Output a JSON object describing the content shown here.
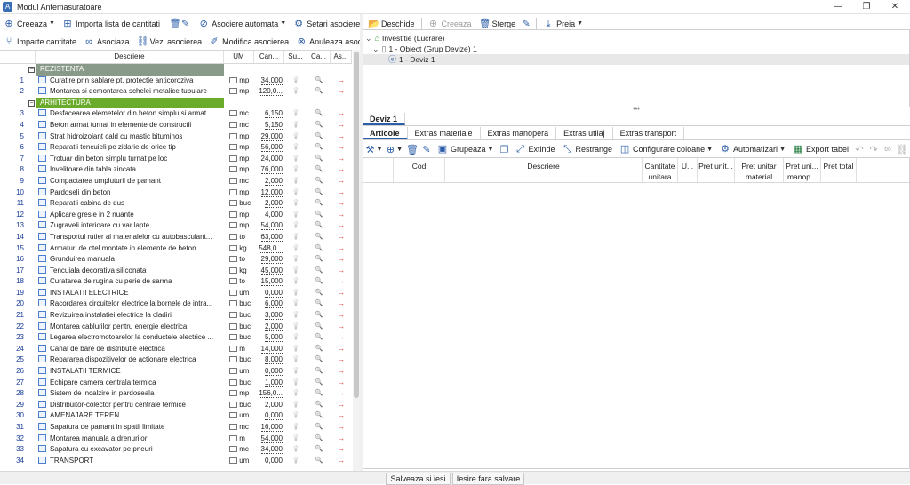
{
  "window": {
    "title": "Modul Antemasuratoare",
    "controls": [
      "—",
      "❐",
      "✕"
    ]
  },
  "left_toolbar1": {
    "create": "Creeaza",
    "import": "Importa lista de cantitati",
    "auto_assoc": "Asociere automata",
    "assoc_settings": "Setari asociere"
  },
  "left_toolbar2": {
    "split_qty": "Imparte cantitate",
    "associate": "Asociaza",
    "view_assoc": "Vezi asocierea",
    "modify_assoc": "Modifica asocierea",
    "cancel_assoc": "Anuleaza asocierea"
  },
  "left_grid": {
    "headers": {
      "desc": "Descriere",
      "um": "UM",
      "qty": "Can...",
      "su": "Su...",
      "ca": "Ca...",
      "as": "As..."
    },
    "groups": {
      "rezistenta": "REZISTENTA",
      "arhitectura": "ARHITECTURA"
    },
    "rows": [
      {
        "n": "1",
        "d": "Curatire prin sablare pt. protectie anticoroziva",
        "u": "mp",
        "q": "34,000"
      },
      {
        "n": "2",
        "d": "Montarea si demontarea schelei metalice tubulare",
        "u": "mp",
        "q": "120,0..."
      },
      {
        "n": "3",
        "d": "Desfacearea elemetelor din beton simplu si armat",
        "u": "mc",
        "q": "6,150"
      },
      {
        "n": "4",
        "d": "Beton armat turnat in elemente de constructii",
        "u": "mc",
        "q": "5,150"
      },
      {
        "n": "5",
        "d": "Strat hidroizolant cald cu mastic bituminos",
        "u": "mp",
        "q": "29,000"
      },
      {
        "n": "6",
        "d": "Reparatii tencuieli pe zidarie de orice tip",
        "u": "mp",
        "q": "56,000"
      },
      {
        "n": "7",
        "d": "Trotuar din beton simplu turnat pe loc",
        "u": "mp",
        "q": "24,000"
      },
      {
        "n": "8",
        "d": "Invelitoare din tabla zincata",
        "u": "mp",
        "q": "76,000"
      },
      {
        "n": "9",
        "d": "Compactarea umpluturii de pamant",
        "u": "mc",
        "q": "2,000"
      },
      {
        "n": "10",
        "d": "Pardoseli din beton",
        "u": "mp",
        "q": "12,000"
      },
      {
        "n": "11",
        "d": "Reparatii cabina de dus",
        "u": "buc",
        "q": "2,000"
      },
      {
        "n": "12",
        "d": "Aplicare gresie in 2 nuante",
        "u": "mp",
        "q": "4,000"
      },
      {
        "n": "13",
        "d": "Zugraveli interioare cu var lapte",
        "u": "mp",
        "q": "54,000"
      },
      {
        "n": "14",
        "d": "Transportul rutier al materialelor cu autobasculant...",
        "u": "to",
        "q": "63,000"
      },
      {
        "n": "15",
        "d": "Armaturi de otel montate in elemente de beton",
        "u": "kg",
        "q": "548,0..."
      },
      {
        "n": "16",
        "d": "Grunduirea manuala",
        "u": "to",
        "q": "29,000"
      },
      {
        "n": "17",
        "d": "Tencuiala decorativa siliconata",
        "u": "kg",
        "q": "45,000"
      },
      {
        "n": "18",
        "d": "Curatarea de rugina cu perie de sarma",
        "u": "to",
        "q": "15,000"
      },
      {
        "n": "19",
        "d": "INSTALATII ELECTRICE",
        "u": "um",
        "q": "0,000"
      },
      {
        "n": "20",
        "d": "Racordarea circuitelor electrice la bornele de intra...",
        "u": "buc",
        "q": "6,000"
      },
      {
        "n": "21",
        "d": "Revizuirea instalatiei electrice la cladiri",
        "u": "buc",
        "q": "3,000"
      },
      {
        "n": "22",
        "d": "Montarea cablurilor pentru energie electrica",
        "u": "buc",
        "q": "2,000"
      },
      {
        "n": "23",
        "d": "Legarea electromotoarelor la conductele electrice ...",
        "u": "buc",
        "q": "5,000"
      },
      {
        "n": "24",
        "d": "Canal de bare de distributie electrica",
        "u": "m",
        "q": "14,000"
      },
      {
        "n": "25",
        "d": "Repararea dispozitivelor de actionare electrica",
        "u": "buc",
        "q": "8,000"
      },
      {
        "n": "26",
        "d": "INSTALATII TERMICE",
        "u": "um",
        "q": "0,000"
      },
      {
        "n": "27",
        "d": "Echipare camera centrala termica",
        "u": "buc",
        "q": "1,000"
      },
      {
        "n": "28",
        "d": "Sistem de incalzire in pardoseala",
        "u": "mp",
        "q": "156,0..."
      },
      {
        "n": "29",
        "d": "Distribuitor-colector pentru centrale termice",
        "u": "buc",
        "q": "2,000"
      },
      {
        "n": "30",
        "d": "AMENAJARE TEREN",
        "u": "um",
        "q": "0,000"
      },
      {
        "n": "31",
        "d": "Sapatura de pamant in spatii limitate",
        "u": "mc",
        "q": "16,000"
      },
      {
        "n": "32",
        "d": "Montarea manuala a drenurilor",
        "u": "m",
        "q": "54,000"
      },
      {
        "n": "33",
        "d": "Sapatura cu excavator pe pneuri",
        "u": "mc",
        "q": "34,000"
      },
      {
        "n": "34",
        "d": "TRANSPORT",
        "u": "um",
        "q": "0,000"
      }
    ]
  },
  "right_toolbar": {
    "open": "Deschide",
    "create": "Creeaza",
    "delete": "Sterge",
    "take": "Preia"
  },
  "tree": {
    "root": "Investitie (Lucrare)",
    "object": "1 - Obiect (Grup Devize) 1",
    "deviz": "1 - Deviz 1"
  },
  "deviz_tab": "Deviz 1",
  "sub_tabs": [
    "Articole",
    "Extras materiale",
    "Extras manopera",
    "Extras utilaj",
    "Extras transport"
  ],
  "grid_toolbar": {
    "group": "Grupeaza",
    "expand": "Extinde",
    "collapse": "Restrange",
    "columns": "Configurare coloane",
    "automations": "Automatizari",
    "export": "Export tabel"
  },
  "right_grid": {
    "headers": [
      "Cod",
      "Descriere",
      "Cantitate unitara",
      "U...",
      "Pret unit...",
      "Pret unitar material",
      "Pret uni... manop...",
      "Pret total"
    ]
  },
  "footer": {
    "save_exit": "Salveaza si iesi",
    "exit_nosave": "Iesire fara salvare"
  }
}
